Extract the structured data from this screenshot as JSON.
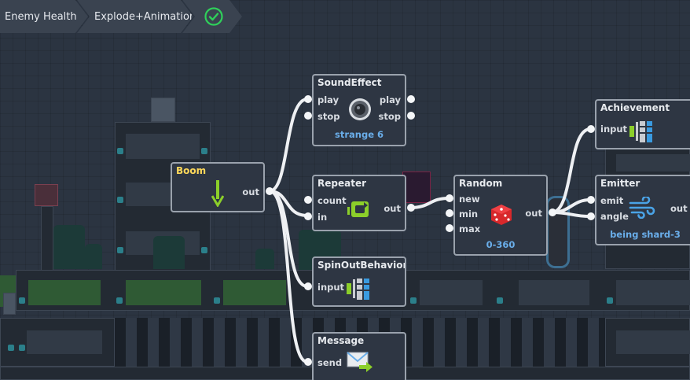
{
  "breadcrumb": {
    "items": [
      "Enemy Health",
      "Explode+Animation"
    ],
    "done_icon": "check-circle-icon",
    "done_color": "#2fd05a"
  },
  "nodes": {
    "sound_effect": {
      "title": "SoundEffect",
      "in": [
        "play",
        "stop"
      ],
      "out": [
        "play",
        "stop"
      ],
      "subtitle": "strange 6",
      "icon": "speaker-icon"
    },
    "boom": {
      "title": "Boom",
      "out": "out",
      "icon": "arrow-down-icon"
    },
    "repeater": {
      "title": "Repeater",
      "in": [
        "count",
        "in"
      ],
      "out": "out",
      "icon": "loop-icon"
    },
    "random": {
      "title": "Random",
      "in": [
        "new",
        "min",
        "max"
      ],
      "out": "out",
      "subtitle": "0-360",
      "icon": "dice-icon"
    },
    "spin_out": {
      "title": "SpinOutBehaviorDe",
      "in": [
        "input"
      ],
      "icon": "behavior-grid-icon"
    },
    "message": {
      "title": "Message",
      "in": [
        "send"
      ],
      "icon": "envelope-icon"
    },
    "achievement": {
      "title": "Achievement",
      "in": [
        "input"
      ],
      "icon": "behavior-grid-icon"
    },
    "emitter": {
      "title": "Emitter",
      "in": [
        "emit",
        "angle"
      ],
      "out": "out",
      "subtitle": "being shard-3",
      "icon": "wind-icon"
    }
  },
  "colors": {
    "canvas": "#2b3441",
    "node_bg": "#2e3643",
    "node_border": "#9aa2ad",
    "boom_title": "#ffd95a",
    "subtitle": "#6aaeea",
    "wire": "#eef0f3",
    "accent_green": "#8ccf2a"
  }
}
